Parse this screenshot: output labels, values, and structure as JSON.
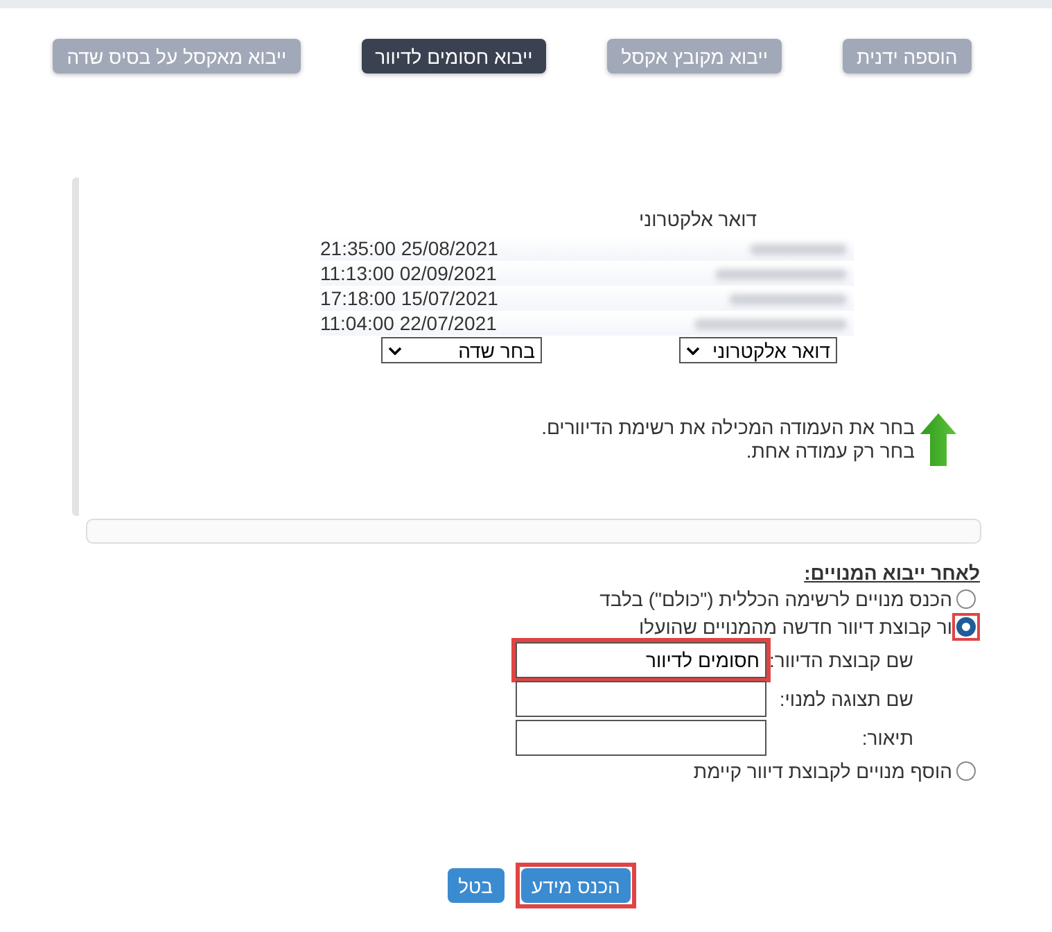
{
  "tabs": [
    {
      "label": "הוספה ידנית",
      "selected": false
    },
    {
      "label": "ייבוא מקובץ אקסל",
      "selected": false
    },
    {
      "label": "ייבוא חסומים לדיוור",
      "selected": true
    },
    {
      "label": "ייבוא מאקסל על בסיס שדה",
      "selected": false
    }
  ],
  "preview": {
    "columns": [
      {
        "kind": "blurred",
        "header": "דואר אלקטרוני",
        "select": "דואר אלקטרוני"
      },
      {
        "kind": "text",
        "cells": [
          "21:35:00 25/08/2021",
          "11:13:00 02/09/2021",
          "17:18:00 15/07/2021",
          "11:04:00 22/07/2021"
        ],
        "select": "בחר שדה"
      }
    ],
    "hint": [
      "בחר את העמודה המכילה את רשימת הדיוורים.",
      "בחר רק עמודה אחת."
    ]
  },
  "after_import": {
    "title": "לאחר ייבוא המנויים:",
    "options": [
      {
        "label": "הכנס מנויים לרשימה הכללית (\"כולם\") בלבד",
        "selected": false,
        "highlighted": false
      },
      {
        "label": "ור קבוצת דיוור חדשה מהמנויים שהועלו",
        "selected": true,
        "highlighted": true,
        "fields": [
          {
            "label": "שם קבוצת הדיוור:",
            "value": "חסומים לדיוור",
            "highlighted": true
          },
          {
            "label": "שם תצוגה למנוי:",
            "highlighted": false
          },
          {
            "label": "תיאור:",
            "highlighted": false
          }
        ]
      },
      {
        "label": "הוסף מנויים לקבוצת דיוור קיימת",
        "selected": false,
        "highlighted": false
      }
    ]
  },
  "buttons": [
    {
      "label": "הכנס מידע",
      "highlighted": true
    },
    {
      "label": "בטל",
      "highlighted": false
    }
  ]
}
